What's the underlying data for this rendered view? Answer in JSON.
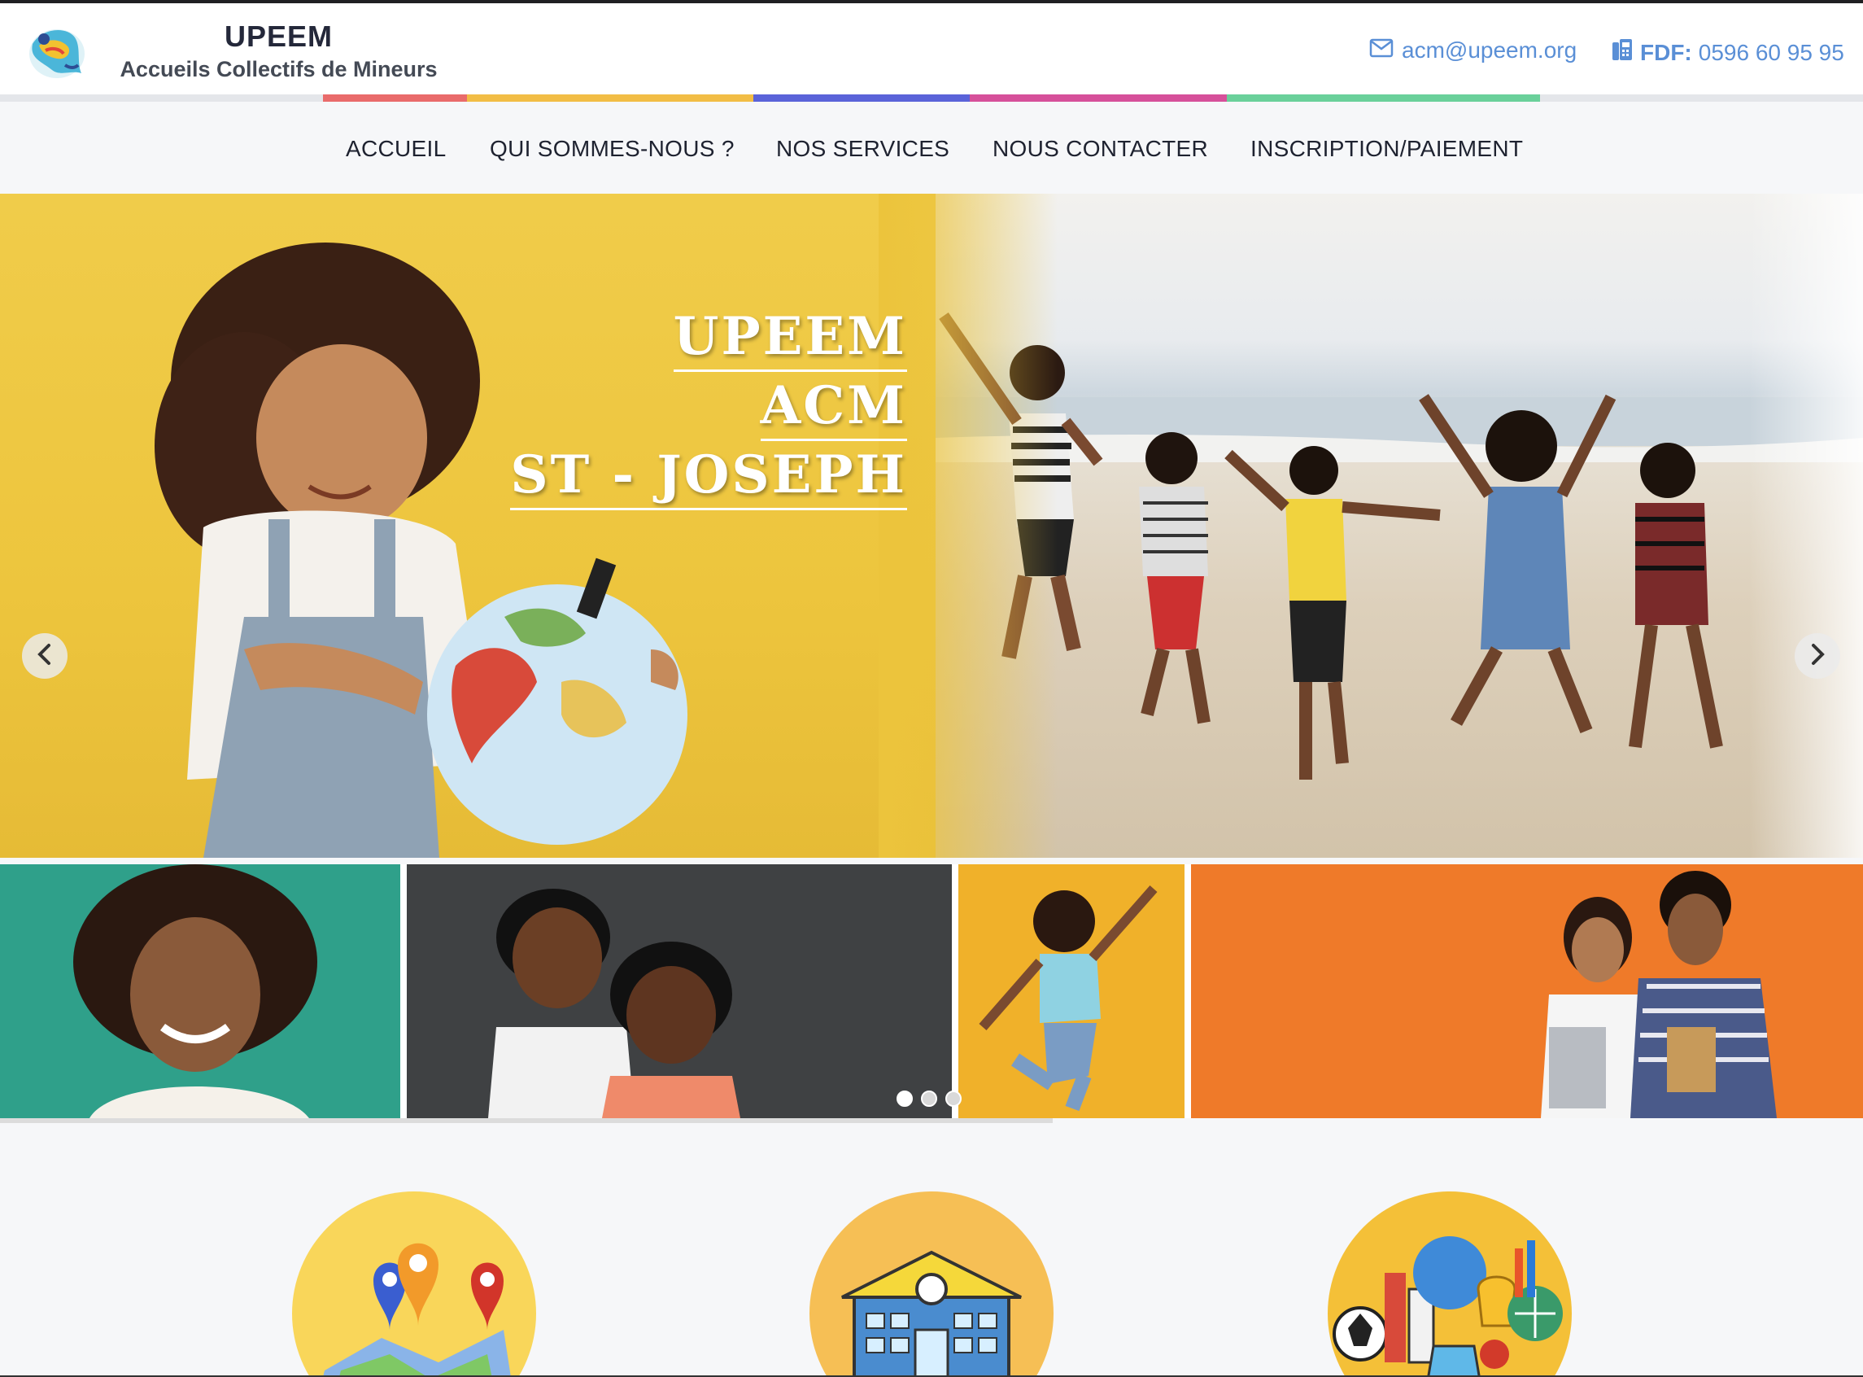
{
  "header": {
    "brand_title": "UPEEM",
    "brand_subtitle": "Accueils Collectifs de Mineurs",
    "email_icon": "envelope-icon",
    "email": "acm@upeem.org",
    "phone_icon": "fax-icon",
    "phone_label": "FDF:",
    "phone_number": "0596 60 95 95",
    "stripe_colors": [
      "#e96b6b",
      "#f2bd45",
      "#5a63d9",
      "#d6509a",
      "#6ad09a"
    ]
  },
  "nav": {
    "items": [
      {
        "label": "ACCUEIL"
      },
      {
        "label": "QUI SOMMES-NOUS ?"
      },
      {
        "label": "NOS SERVICES"
      },
      {
        "label": "NOUS CONTACTER"
      },
      {
        "label": "INSCRIPTION/PAIEMENT"
      }
    ]
  },
  "hero": {
    "lines": [
      "UPEEM",
      "ACM",
      "ST - JOSEPH"
    ],
    "prev_icon": "chevron-left-icon",
    "next_icon": "chevron-right-icon"
  },
  "thumbnails": {
    "bg_colors": [
      "#2fa08a",
      "#3f4143",
      "#f0b12a",
      "#ef7a29"
    ],
    "dots": 3,
    "active_dot": 0
  },
  "features": {
    "icons": [
      "map-pins-icon",
      "school-building-icon",
      "school-supplies-icon"
    ],
    "circle_colors": [
      "#f9d65a",
      "#f6bf55",
      "#f4c038"
    ]
  }
}
